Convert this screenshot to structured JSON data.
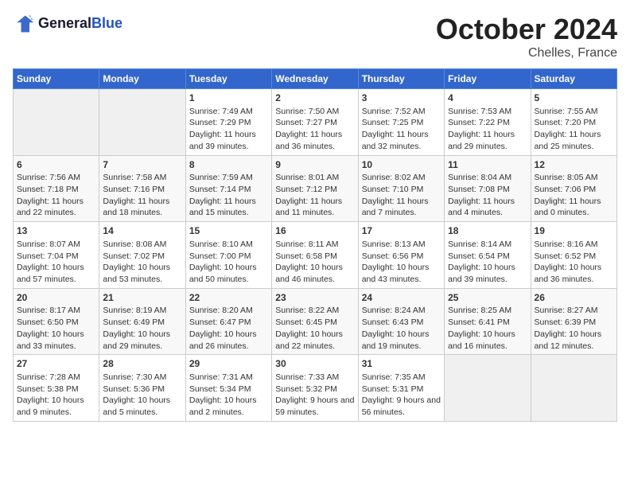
{
  "header": {
    "logo_general": "General",
    "logo_blue": "Blue",
    "month_title": "October 2024",
    "subtitle": "Chelles, France"
  },
  "days_of_week": [
    "Sunday",
    "Monday",
    "Tuesday",
    "Wednesday",
    "Thursday",
    "Friday",
    "Saturday"
  ],
  "weeks": [
    [
      {
        "day": "",
        "empty": true
      },
      {
        "day": "",
        "empty": true
      },
      {
        "day": "1",
        "detail": "Sunrise: 7:49 AM\nSunset: 7:29 PM\nDaylight: 11 hours and 39 minutes."
      },
      {
        "day": "2",
        "detail": "Sunrise: 7:50 AM\nSunset: 7:27 PM\nDaylight: 11 hours and 36 minutes."
      },
      {
        "day": "3",
        "detail": "Sunrise: 7:52 AM\nSunset: 7:25 PM\nDaylight: 11 hours and 32 minutes."
      },
      {
        "day": "4",
        "detail": "Sunrise: 7:53 AM\nSunset: 7:22 PM\nDaylight: 11 hours and 29 minutes."
      },
      {
        "day": "5",
        "detail": "Sunrise: 7:55 AM\nSunset: 7:20 PM\nDaylight: 11 hours and 25 minutes."
      }
    ],
    [
      {
        "day": "6",
        "detail": "Sunrise: 7:56 AM\nSunset: 7:18 PM\nDaylight: 11 hours and 22 minutes."
      },
      {
        "day": "7",
        "detail": "Sunrise: 7:58 AM\nSunset: 7:16 PM\nDaylight: 11 hours and 18 minutes."
      },
      {
        "day": "8",
        "detail": "Sunrise: 7:59 AM\nSunset: 7:14 PM\nDaylight: 11 hours and 15 minutes."
      },
      {
        "day": "9",
        "detail": "Sunrise: 8:01 AM\nSunset: 7:12 PM\nDaylight: 11 hours and 11 minutes."
      },
      {
        "day": "10",
        "detail": "Sunrise: 8:02 AM\nSunset: 7:10 PM\nDaylight: 11 hours and 7 minutes."
      },
      {
        "day": "11",
        "detail": "Sunrise: 8:04 AM\nSunset: 7:08 PM\nDaylight: 11 hours and 4 minutes."
      },
      {
        "day": "12",
        "detail": "Sunrise: 8:05 AM\nSunset: 7:06 PM\nDaylight: 11 hours and 0 minutes."
      }
    ],
    [
      {
        "day": "13",
        "detail": "Sunrise: 8:07 AM\nSunset: 7:04 PM\nDaylight: 10 hours and 57 minutes."
      },
      {
        "day": "14",
        "detail": "Sunrise: 8:08 AM\nSunset: 7:02 PM\nDaylight: 10 hours and 53 minutes."
      },
      {
        "day": "15",
        "detail": "Sunrise: 8:10 AM\nSunset: 7:00 PM\nDaylight: 10 hours and 50 minutes."
      },
      {
        "day": "16",
        "detail": "Sunrise: 8:11 AM\nSunset: 6:58 PM\nDaylight: 10 hours and 46 minutes."
      },
      {
        "day": "17",
        "detail": "Sunrise: 8:13 AM\nSunset: 6:56 PM\nDaylight: 10 hours and 43 minutes."
      },
      {
        "day": "18",
        "detail": "Sunrise: 8:14 AM\nSunset: 6:54 PM\nDaylight: 10 hours and 39 minutes."
      },
      {
        "day": "19",
        "detail": "Sunrise: 8:16 AM\nSunset: 6:52 PM\nDaylight: 10 hours and 36 minutes."
      }
    ],
    [
      {
        "day": "20",
        "detail": "Sunrise: 8:17 AM\nSunset: 6:50 PM\nDaylight: 10 hours and 33 minutes."
      },
      {
        "day": "21",
        "detail": "Sunrise: 8:19 AM\nSunset: 6:49 PM\nDaylight: 10 hours and 29 minutes."
      },
      {
        "day": "22",
        "detail": "Sunrise: 8:20 AM\nSunset: 6:47 PM\nDaylight: 10 hours and 26 minutes."
      },
      {
        "day": "23",
        "detail": "Sunrise: 8:22 AM\nSunset: 6:45 PM\nDaylight: 10 hours and 22 minutes."
      },
      {
        "day": "24",
        "detail": "Sunrise: 8:24 AM\nSunset: 6:43 PM\nDaylight: 10 hours and 19 minutes."
      },
      {
        "day": "25",
        "detail": "Sunrise: 8:25 AM\nSunset: 6:41 PM\nDaylight: 10 hours and 16 minutes."
      },
      {
        "day": "26",
        "detail": "Sunrise: 8:27 AM\nSunset: 6:39 PM\nDaylight: 10 hours and 12 minutes."
      }
    ],
    [
      {
        "day": "27",
        "detail": "Sunrise: 7:28 AM\nSunset: 5:38 PM\nDaylight: 10 hours and 9 minutes."
      },
      {
        "day": "28",
        "detail": "Sunrise: 7:30 AM\nSunset: 5:36 PM\nDaylight: 10 hours and 5 minutes."
      },
      {
        "day": "29",
        "detail": "Sunrise: 7:31 AM\nSunset: 5:34 PM\nDaylight: 10 hours and 2 minutes."
      },
      {
        "day": "30",
        "detail": "Sunrise: 7:33 AM\nSunset: 5:32 PM\nDaylight: 9 hours and 59 minutes."
      },
      {
        "day": "31",
        "detail": "Sunrise: 7:35 AM\nSunset: 5:31 PM\nDaylight: 9 hours and 56 minutes."
      },
      {
        "day": "",
        "empty": true
      },
      {
        "day": "",
        "empty": true
      }
    ]
  ]
}
